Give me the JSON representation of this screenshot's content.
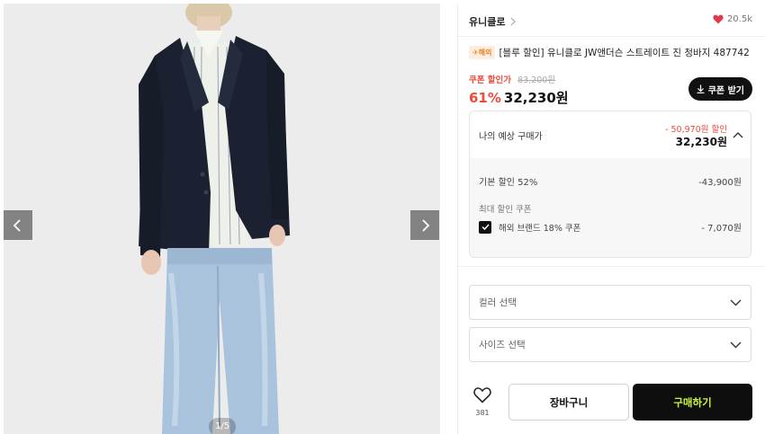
{
  "gallery": {
    "counter": "1/5",
    "colors": {
      "background": "#ececec",
      "jacket": "#1b2130",
      "jeans": "#a9c3dc",
      "shirt": "#eef0ea"
    }
  },
  "brand": {
    "name": "유니클로",
    "like_count": "20.5k",
    "heart_color": "#e23a4a"
  },
  "product": {
    "overseas_badge": "해외",
    "title": "[블루 할인] 유니클로 JW앤더슨 스트레이트 진 청바지 487742"
  },
  "price": {
    "coupon_label": "쿠폰 할인가",
    "original": "83,200원",
    "discount_percent": "61%",
    "final": "32,230원",
    "coupon_button": "쿠폰 받기",
    "accent_color": "#ee4a3a"
  },
  "estimate": {
    "label": "나의 예상 구매가",
    "discount_total": "- 50,970원 할인",
    "total": "32,230원",
    "basic_discount_label": "기본 할인 52%",
    "basic_discount_value": "-43,900원",
    "max_coupon_label": "최대 할인 쿠폰",
    "coupon_name": "해외 브랜드 18% 쿠폰",
    "coupon_value": "- 7,070원"
  },
  "options": {
    "color_placeholder": "컬러 선택",
    "size_placeholder": "사이즈 선택"
  },
  "actions": {
    "wish_count": "381",
    "cart_label": "장바구니",
    "buy_label": "구매하기",
    "buy_text_color": "#c8f53a"
  }
}
